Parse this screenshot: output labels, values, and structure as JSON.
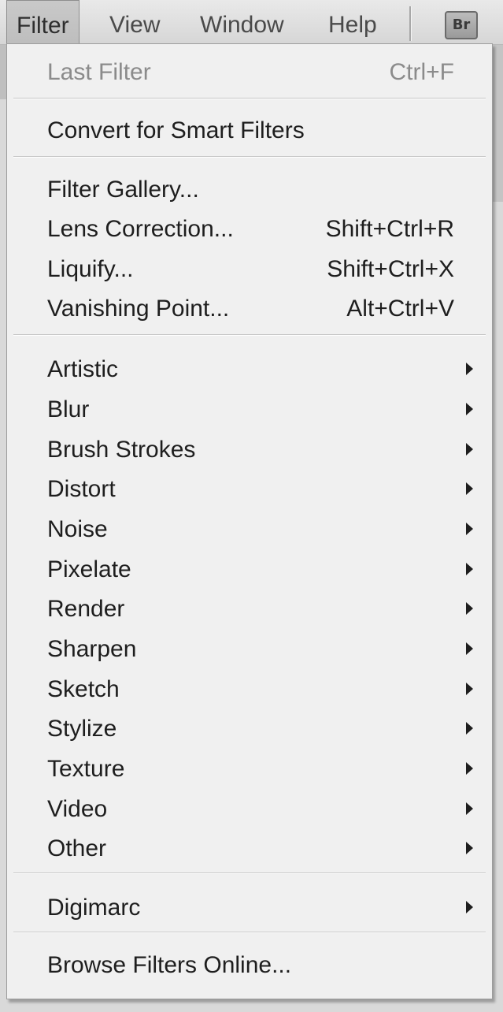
{
  "menubar": {
    "items": [
      {
        "label": "Filter",
        "active": true
      },
      {
        "label": "View",
        "active": false
      },
      {
        "label": "Window",
        "active": false
      },
      {
        "label": "Help",
        "active": false
      }
    ],
    "bridge_button": "Br"
  },
  "menu": {
    "sections": [
      {
        "items": [
          {
            "label": "Last Filter",
            "shortcut": "Ctrl+F",
            "disabled": true,
            "submenu": false
          }
        ]
      },
      {
        "items": [
          {
            "label": "Convert for Smart Filters",
            "shortcut": "",
            "disabled": false,
            "submenu": false
          }
        ]
      },
      {
        "items": [
          {
            "label": "Filter Gallery...",
            "shortcut": "",
            "disabled": false,
            "submenu": false
          },
          {
            "label": "Lens Correction...",
            "shortcut": "Shift+Ctrl+R",
            "disabled": false,
            "submenu": false
          },
          {
            "label": "Liquify...",
            "shortcut": "Shift+Ctrl+X",
            "disabled": false,
            "submenu": false
          },
          {
            "label": "Vanishing Point...",
            "shortcut": "Alt+Ctrl+V",
            "disabled": false,
            "submenu": false
          }
        ]
      },
      {
        "items": [
          {
            "label": "Artistic",
            "shortcut": "",
            "disabled": false,
            "submenu": true
          },
          {
            "label": "Blur",
            "shortcut": "",
            "disabled": false,
            "submenu": true
          },
          {
            "label": "Brush Strokes",
            "shortcut": "",
            "disabled": false,
            "submenu": true
          },
          {
            "label": "Distort",
            "shortcut": "",
            "disabled": false,
            "submenu": true
          },
          {
            "label": "Noise",
            "shortcut": "",
            "disabled": false,
            "submenu": true
          },
          {
            "label": "Pixelate",
            "shortcut": "",
            "disabled": false,
            "submenu": true
          },
          {
            "label": "Render",
            "shortcut": "",
            "disabled": false,
            "submenu": true
          },
          {
            "label": "Sharpen",
            "shortcut": "",
            "disabled": false,
            "submenu": true
          },
          {
            "label": "Sketch",
            "shortcut": "",
            "disabled": false,
            "submenu": true
          },
          {
            "label": "Stylize",
            "shortcut": "",
            "disabled": false,
            "submenu": true
          },
          {
            "label": "Texture",
            "shortcut": "",
            "disabled": false,
            "submenu": true
          },
          {
            "label": "Video",
            "shortcut": "",
            "disabled": false,
            "submenu": true
          },
          {
            "label": "Other",
            "shortcut": "",
            "disabled": false,
            "submenu": true
          }
        ]
      },
      {
        "items": [
          {
            "label": "Digimarc",
            "shortcut": "",
            "disabled": false,
            "submenu": true
          }
        ]
      },
      {
        "items": [
          {
            "label": "Browse Filters Online...",
            "shortcut": "",
            "disabled": false,
            "submenu": false
          }
        ]
      }
    ]
  },
  "colors": {
    "menu_background": "#f0f0f0",
    "text": "#1e1e1e",
    "disabled_text": "#8b8b8b"
  }
}
